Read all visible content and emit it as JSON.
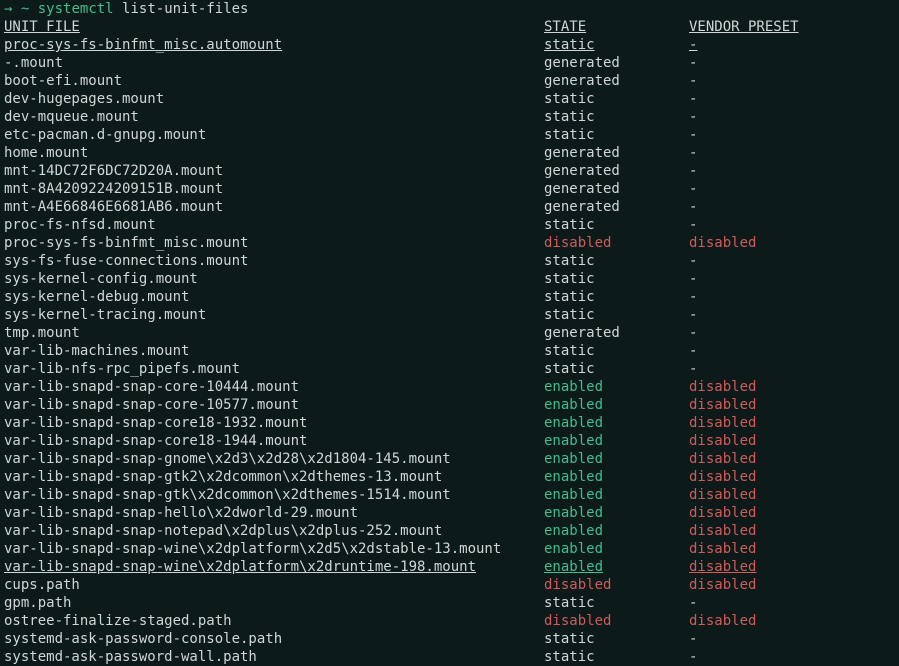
{
  "prompt": {
    "arrow": "→",
    "tilde": "~",
    "command": "systemctl",
    "args": "list-unit-files"
  },
  "headers": {
    "unit": "UNIT FILE",
    "state": "STATE",
    "preset": "VENDOR PRESET"
  },
  "rows": [
    {
      "unit": "proc-sys-fs-binfmt_misc.automount",
      "state": "static",
      "preset": "-",
      "underline": true
    },
    {
      "unit": "-.mount",
      "state": "generated",
      "preset": "-"
    },
    {
      "unit": "boot-efi.mount",
      "state": "generated",
      "preset": "-"
    },
    {
      "unit": "dev-hugepages.mount",
      "state": "static",
      "preset": "-"
    },
    {
      "unit": "dev-mqueue.mount",
      "state": "static",
      "preset": "-"
    },
    {
      "unit": "etc-pacman.d-gnupg.mount",
      "state": "static",
      "preset": "-"
    },
    {
      "unit": "home.mount",
      "state": "generated",
      "preset": "-"
    },
    {
      "unit": "mnt-14DC72F6DC72D20A.mount",
      "state": "generated",
      "preset": "-"
    },
    {
      "unit": "mnt-8A4209224209151B.mount",
      "state": "generated",
      "preset": "-"
    },
    {
      "unit": "mnt-A4E66846E6681AB6.mount",
      "state": "generated",
      "preset": "-"
    },
    {
      "unit": "proc-fs-nfsd.mount",
      "state": "static",
      "preset": "-"
    },
    {
      "unit": "proc-sys-fs-binfmt_misc.mount",
      "state": "disabled",
      "preset": "disabled"
    },
    {
      "unit": "sys-fs-fuse-connections.mount",
      "state": "static",
      "preset": "-"
    },
    {
      "unit": "sys-kernel-config.mount",
      "state": "static",
      "preset": "-"
    },
    {
      "unit": "sys-kernel-debug.mount",
      "state": "static",
      "preset": "-"
    },
    {
      "unit": "sys-kernel-tracing.mount",
      "state": "static",
      "preset": "-"
    },
    {
      "unit": "tmp.mount",
      "state": "generated",
      "preset": "-"
    },
    {
      "unit": "var-lib-machines.mount",
      "state": "static",
      "preset": "-"
    },
    {
      "unit": "var-lib-nfs-rpc_pipefs.mount",
      "state": "static",
      "preset": "-"
    },
    {
      "unit": "var-lib-snapd-snap-core-10444.mount",
      "state": "enabled",
      "preset": "disabled"
    },
    {
      "unit": "var-lib-snapd-snap-core-10577.mount",
      "state": "enabled",
      "preset": "disabled"
    },
    {
      "unit": "var-lib-snapd-snap-core18-1932.mount",
      "state": "enabled",
      "preset": "disabled"
    },
    {
      "unit": "var-lib-snapd-snap-core18-1944.mount",
      "state": "enabled",
      "preset": "disabled"
    },
    {
      "unit": "var-lib-snapd-snap-gnome\\x2d3\\x2d28\\x2d1804-145.mount",
      "state": "enabled",
      "preset": "disabled"
    },
    {
      "unit": "var-lib-snapd-snap-gtk2\\x2dcommon\\x2dthemes-13.mount",
      "state": "enabled",
      "preset": "disabled"
    },
    {
      "unit": "var-lib-snapd-snap-gtk\\x2dcommon\\x2dthemes-1514.mount",
      "state": "enabled",
      "preset": "disabled"
    },
    {
      "unit": "var-lib-snapd-snap-hello\\x2dworld-29.mount",
      "state": "enabled",
      "preset": "disabled"
    },
    {
      "unit": "var-lib-snapd-snap-notepad\\x2dplus\\x2dplus-252.mount",
      "state": "enabled",
      "preset": "disabled"
    },
    {
      "unit": "var-lib-snapd-snap-wine\\x2dplatform\\x2d5\\x2dstable-13.mount",
      "state": "enabled",
      "preset": "disabled"
    },
    {
      "unit": "var-lib-snapd-snap-wine\\x2dplatform\\x2druntime-198.mount",
      "state": "enabled",
      "preset": "disabled",
      "underline": true
    },
    {
      "unit": "cups.path",
      "state": "disabled",
      "preset": "disabled"
    },
    {
      "unit": "gpm.path",
      "state": "static",
      "preset": "-"
    },
    {
      "unit": "ostree-finalize-staged.path",
      "state": "disabled",
      "preset": "disabled"
    },
    {
      "unit": "systemd-ask-password-console.path",
      "state": "static",
      "preset": "-"
    },
    {
      "unit": "systemd-ask-password-wall.path",
      "state": "static",
      "preset": "-"
    }
  ]
}
